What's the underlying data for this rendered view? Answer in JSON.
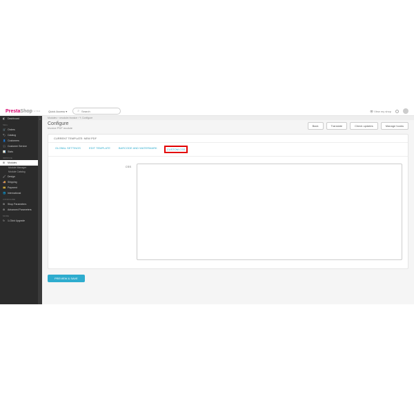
{
  "brand": {
    "a": "Presta",
    "b": "Shop",
    "v": "1.7.6.3"
  },
  "quickAccess": "Quick Access ▾",
  "search": {
    "placeholder": "Search"
  },
  "topright": {
    "view": "View my shop"
  },
  "crumb": "Modules › <module>Invoice › ✎ Configure",
  "page": {
    "title": "Configure",
    "sub": "Invoice PDF module"
  },
  "buttons": {
    "back": "Back",
    "translate": "Translate",
    "check": "Check updates",
    "hooks": "Manage hooks"
  },
  "panel": {
    "header": "CURRENT TEMPLATE: NEW PDF"
  },
  "tabs": {
    "a": "GLOBAL SETTINGS",
    "b": "EDIT TEMPLATE",
    "c": "BARCODE AND WATERMARK",
    "d": "CUSTOM CSS"
  },
  "form": {
    "label": "CSS",
    "save": "PREVIEW & SAVE"
  },
  "sidebar": {
    "dashboard": "Dashboard",
    "sell": "SELL",
    "orders": "Orders",
    "catalog": "Catalog",
    "customers": "Customers",
    "cs": "Customer Service",
    "stats": "Stats",
    "improve": "IMPROVE",
    "modules": "Modules",
    "mm": "Module Manager",
    "mc": "Module Catalog",
    "design": "Design",
    "shipping": "Shipping",
    "payment": "Payment",
    "intl": "International",
    "configure": "CONFIGURE",
    "shopp": "Shop Parameters",
    "advp": "Advanced Parameters",
    "more": "MORE",
    "upgrade": "1-Click Upgrade"
  }
}
